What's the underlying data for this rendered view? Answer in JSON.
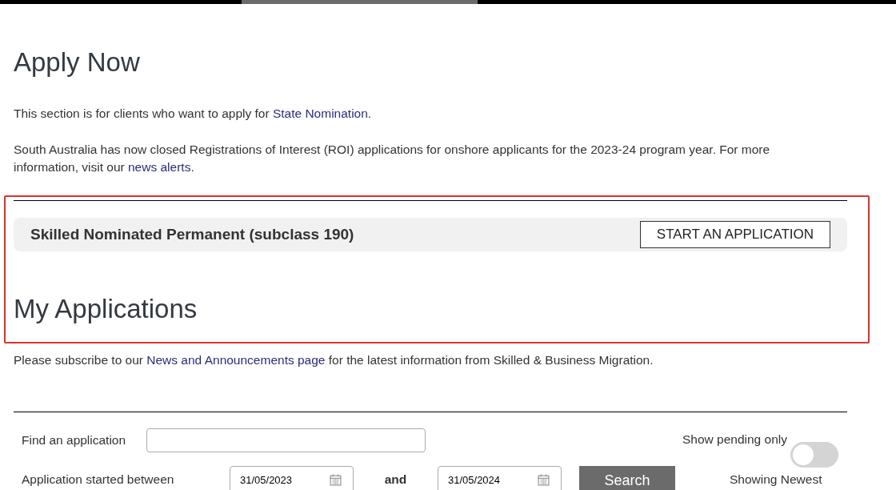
{
  "top_bar": {
    "segments": [
      {
        "selected": false
      },
      {
        "selected": true
      },
      {
        "selected": false
      }
    ]
  },
  "apply": {
    "title": "Apply Now",
    "paragraphs": [
      [
        {
          "kind": "text",
          "text": "This section is for clients who want to apply for "
        },
        {
          "kind": "link",
          "text": "State Nomination"
        },
        {
          "kind": "text",
          "text": "."
        }
      ],
      [
        {
          "kind": "text",
          "text": "South Australia has now closed Registrations of Interest (ROI) applications for onshore applicants for the 2023-24 program year.  For more information, visit our "
        },
        {
          "kind": "link",
          "text": "news alerts"
        },
        {
          "kind": "text",
          "text": "."
        }
      ]
    ],
    "visa": {
      "name": "Skilled Nominated Permanent (subclass 190)",
      "button": "START AN APPLICATION"
    }
  },
  "highlight": {
    "shown": true
  },
  "my_applications": {
    "title": "My Applications",
    "paragraph": [
      {
        "kind": "text",
        "text": "Please subscribe to our "
      },
      {
        "kind": "link",
        "text": "News and Announcements page"
      },
      {
        "kind": "text",
        "text": " for the latest information from Skilled & Business Migration."
      }
    ],
    "filters": {
      "find_label": "Find an application",
      "pending": {
        "label": "Show pending only",
        "on": false
      },
      "started_label": "Application started between",
      "date_from": "31/05/2023",
      "and_label": "and",
      "date_to": "31/05/2024",
      "search_button": "Search",
      "sort_label": "Showing Newest"
    }
  }
}
